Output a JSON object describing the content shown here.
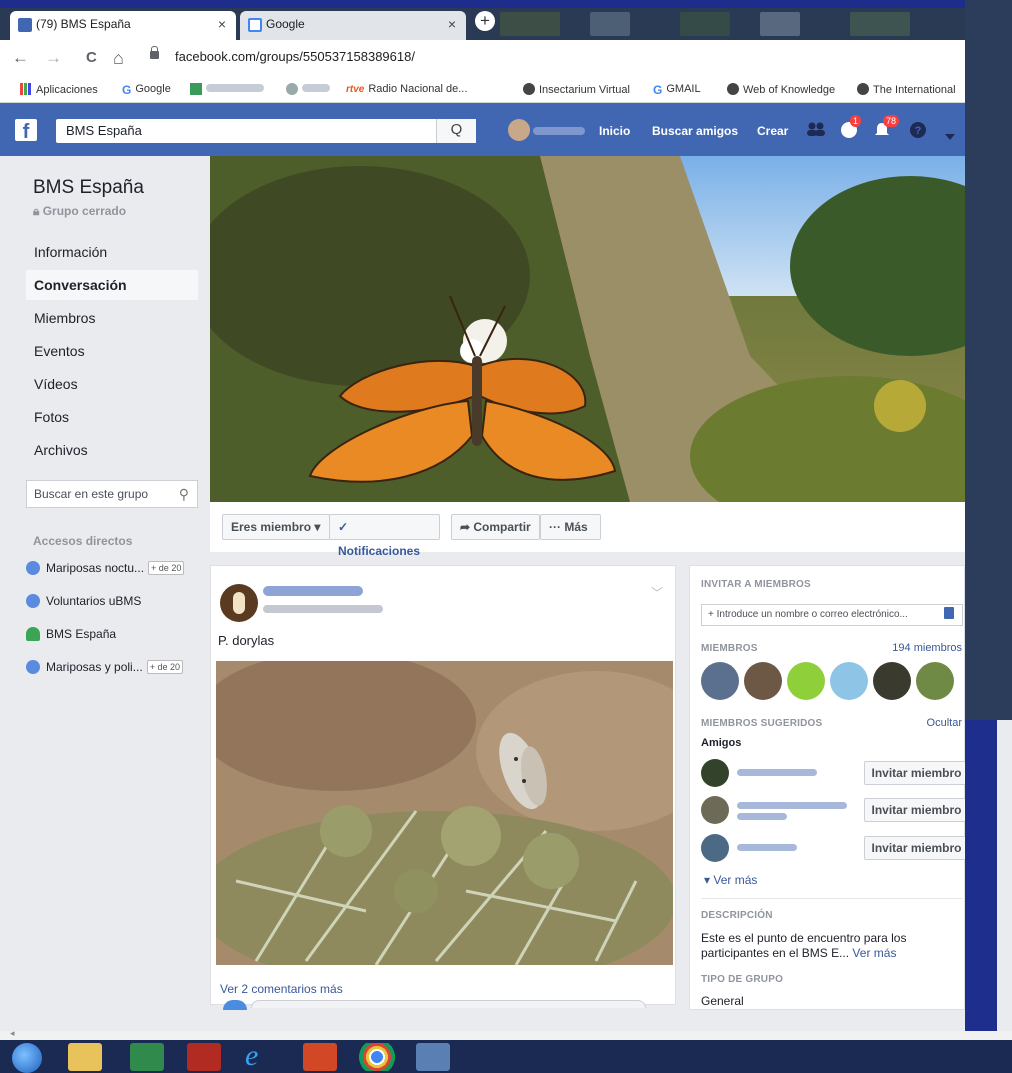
{
  "browser": {
    "tabs": [
      {
        "title": "(79) BMS España",
        "close": "×"
      },
      {
        "title": "Google",
        "close": "×"
      }
    ],
    "new_tab": "+",
    "url": "facebook.com/groups/550537158389618/",
    "nav": {
      "back": "←",
      "forward": "→",
      "reload": "C",
      "home": "⌂"
    },
    "bookmarks": [
      {
        "label": "Aplicaciones",
        "icon": "apps-icon"
      },
      {
        "label": "Google",
        "icon": "google-icon"
      },
      {
        "label": "Radio Nacional de...",
        "prefix": "rtve",
        "icon": "rtve-icon"
      },
      {
        "label": "Insectarium Virtual",
        "icon": "globe-icon"
      },
      {
        "label": "GMAIL",
        "icon": "google-icon"
      },
      {
        "label": "Web of Knowledge",
        "icon": "globe-icon"
      },
      {
        "label": "The International",
        "icon": "globe-icon"
      }
    ]
  },
  "fb_header": {
    "search_value": "BMS España",
    "search_icon": "Q",
    "nav": {
      "inicio": "Inicio",
      "buscar": "Buscar amigos",
      "crear": "Crear"
    },
    "badges": {
      "messages": "1",
      "notifications": "78"
    }
  },
  "group": {
    "name": "BMS España",
    "privacy": "Grupo cerrado",
    "nav": [
      "Información",
      "Conversación",
      "Miembros",
      "Eventos",
      "Vídeos",
      "Fotos",
      "Archivos"
    ],
    "active_nav": "Conversación",
    "search_placeholder": "Buscar en este grupo",
    "shortcuts_title": "Accesos directos",
    "shortcuts": [
      {
        "label": "Mariposas noctu...",
        "tag": "+ de 20"
      },
      {
        "label": "Voluntarios uBMS",
        "tag": ""
      },
      {
        "label": "BMS España",
        "tag": ""
      },
      {
        "label": "Mariposas y poli...",
        "tag": "+ de 20"
      }
    ]
  },
  "actions": {
    "member": "Eres miembro ▾",
    "notifications": "✓ Notificaciones",
    "share": "➦ Compartir",
    "more": "··· Más"
  },
  "post": {
    "text": "P. dorylas",
    "comments_link": "Ver 2 comentarios más"
  },
  "right": {
    "invite_title": "INVITAR A MIEMBROS",
    "invite_placeholder": "+ Introduce un nombre o correo electrónico...",
    "members_title": "MIEMBROS",
    "members_count": "194 miembros",
    "suggested_title": "MIEMBROS SUGERIDOS",
    "hide": "Ocultar",
    "friends_label": "Amigos",
    "invite_button": "Invitar miembro",
    "see_more": "▾  Ver más",
    "description_title": "DESCRIPCIÓN",
    "description": "Este es el punto de encuentro para los participantes en el BMS E...",
    "description_more": "Ver más",
    "type_title": "TIPO DE GRUPO",
    "type_value": "General"
  },
  "colors": {
    "fb_blue": "#4267b2",
    "link": "#385898",
    "slide_background": "#1c2a86"
  }
}
